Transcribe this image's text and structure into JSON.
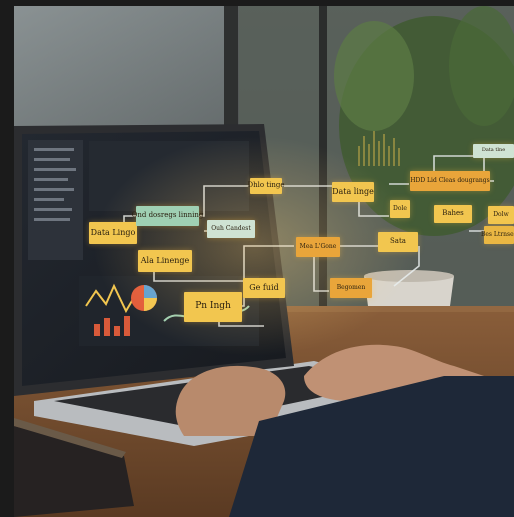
{
  "photo": {
    "subject": "",
    "colors": {
      "background": "#1b1b1b",
      "wall": "#4a4d4d",
      "window_light": "#8b9597",
      "laptop_body": "#2a2b2e",
      "screen": "#1d2126",
      "desk": "#7a5030",
      "sticky_yellow": "#f2c64f",
      "sticky_orange": "#e9a53a",
      "sticky_green": "#9fd0b3",
      "plant": "#4f6e3a",
      "connector": "#e9eef0"
    },
    "icons": [
      "laptop-icon",
      "plant-icon",
      "hand-icon",
      "notebook-icon",
      "pie-chart-icon",
      "bar-chart-icon"
    ]
  },
  "notes": [
    {
      "text": "Data Lingo"
    },
    {
      "text": "Ond dosregs linning"
    },
    {
      "text": "Dhlo tinge"
    },
    {
      "text": "Ala Linenge"
    },
    {
      "text": "Ouh Candest"
    },
    {
      "text": "Data linge"
    },
    {
      "text": "Mea L'Gone"
    },
    {
      "text": "Ge fuid"
    },
    {
      "text": "Pn Ingh"
    },
    {
      "text": "HDD Lid Cleas dougrangs"
    },
    {
      "text": "Dole"
    },
    {
      "text": "Bahes"
    },
    {
      "text": "Sata"
    },
    {
      "text": "Begomen"
    },
    {
      "text": "Dolw"
    },
    {
      "text": "Data tlne"
    },
    {
      "text": "Bes Ltrnsec"
    }
  ]
}
